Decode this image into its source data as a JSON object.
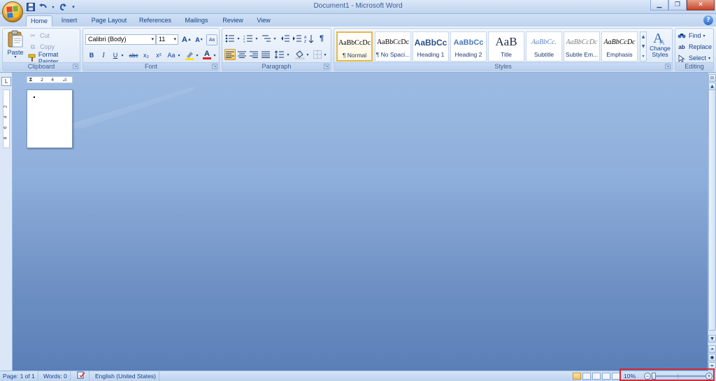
{
  "window": {
    "title": "Document1 - Microsoft Word"
  },
  "quick_access": {
    "items": [
      "save-icon",
      "undo-icon",
      "redo-icon",
      "customize-icon"
    ]
  },
  "tabs": [
    "Home",
    "Insert",
    "Page Layout",
    "References",
    "Mailings",
    "Review",
    "View"
  ],
  "active_tab": "Home",
  "clipboard": {
    "paste": "Paste",
    "cut": "Cut",
    "copy": "Copy",
    "format_painter": "Format Painter",
    "label": "Clipboard"
  },
  "font": {
    "name": "Calibri (Body)",
    "size": "11",
    "label": "Font",
    "bold": "B",
    "italic": "I",
    "underline": "U",
    "strike": "abc",
    "subscript": "x₂",
    "superscript": "x²",
    "change_case": "Aa",
    "grow": "A",
    "shrink": "A",
    "font_color": "A"
  },
  "paragraph": {
    "label": "Paragraph"
  },
  "styles": {
    "label": "Styles",
    "items": [
      {
        "sample": "AaBbCcDc",
        "name": "¶ Normal"
      },
      {
        "sample": "AaBbCcDc",
        "name": "¶ No Spaci..."
      },
      {
        "sample": "AaBbCc",
        "name": "Heading 1"
      },
      {
        "sample": "AaBbCc",
        "name": "Heading 2"
      },
      {
        "sample": "AaB",
        "name": "Title"
      },
      {
        "sample": "AaBbCc.",
        "name": "Subtitle"
      },
      {
        "sample": "AaBbCcDc",
        "name": "Subtle Em..."
      },
      {
        "sample": "AaBbCcDc",
        "name": "Emphasis"
      }
    ],
    "change_styles": "Change Styles"
  },
  "editing": {
    "label": "Editing",
    "find": "Find",
    "replace": "Replace",
    "select": "Select"
  },
  "ruler": {
    "h_ticks": [
      "2",
      "4"
    ],
    "v_ticks": [
      "2",
      "4",
      "6",
      "8"
    ]
  },
  "status": {
    "page": "Page: 1 of 1",
    "words": "Words: 0",
    "language": "English (United States)",
    "zoom": "10%"
  },
  "colors": {
    "accent": "#d42a36",
    "ribbon": "#dde9f8",
    "workspace": "#8eaedb",
    "highlight_yellow": "#f8c35a",
    "font_red": "#e02020"
  }
}
